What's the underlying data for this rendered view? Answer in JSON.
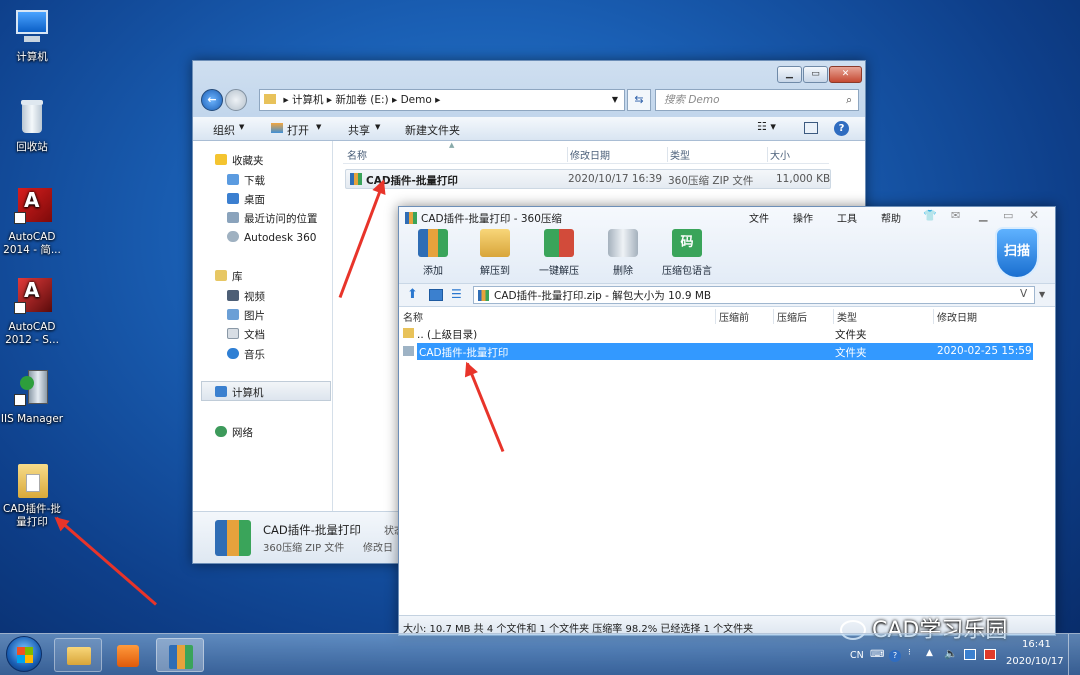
{
  "desktop": {
    "icons": [
      {
        "label": "计算机"
      },
      {
        "label": "回收站"
      },
      {
        "label": "AutoCAD 2014 - 简..."
      },
      {
        "label": "AutoCAD 2012 - S..."
      },
      {
        "label": "IIS Manager"
      },
      {
        "label": "CAD插件-批量打印"
      }
    ]
  },
  "explorer": {
    "path": [
      "计算机",
      "新加卷 (E:)",
      "Demo"
    ],
    "search_placeholder": "搜索 Demo",
    "toolbar": {
      "organize": "组织",
      "open": "打开",
      "share": "共享",
      "new_folder": "新建文件夹"
    },
    "nav": {
      "favorites": "收藏夹",
      "fav_items": [
        "下载",
        "桌面",
        "最近访问的位置",
        "Autodesk 360"
      ],
      "libraries": "库",
      "lib_items": [
        "视频",
        "图片",
        "文档",
        "音乐"
      ],
      "computer": "计算机",
      "network": "网络"
    },
    "columns": [
      "名称",
      "修改日期",
      "类型",
      "大小"
    ],
    "file": {
      "name": "CAD插件-批量打印",
      "date": "2020/10/17 16:39",
      "type": "360压缩 ZIP 文件",
      "size": "11,000 KB"
    },
    "details": {
      "name": "CAD插件-批量打印",
      "type": "360压缩 ZIP 文件",
      "status_label": "状态",
      "modified_label": "修改日"
    }
  },
  "zip": {
    "title": "CAD插件-批量打印 - 360压缩",
    "menu": [
      "文件",
      "操作",
      "工具",
      "帮助"
    ],
    "tools": [
      "添加",
      "解压到",
      "一键解压",
      "删除",
      "压缩包语言"
    ],
    "scan": "扫描",
    "path": "CAD插件-批量打印.zip - 解包大小为 10.9 MB",
    "path_btn": "V",
    "columns": [
      "名称",
      "压缩前",
      "压缩后",
      "类型",
      "修改日期"
    ],
    "rows": [
      {
        "name": ".. (上级目录)",
        "type": "文件夹",
        "date": ""
      },
      {
        "name": "CAD插件-批量打印",
        "type": "文件夹",
        "date": "2020-02-25 15:59"
      }
    ],
    "status": "大小: 10.7 MB 共 4 个文件和 1 个文件夹 压缩率 98.2% 已经选择 1 个文件夹"
  },
  "watermark": "CAD学习乐园",
  "taskbar": {
    "lang": "CN",
    "time": "16:41",
    "date": "2020/10/17"
  },
  "colors": {
    "selection": "#3399ff",
    "arrow": "#e8342a"
  }
}
